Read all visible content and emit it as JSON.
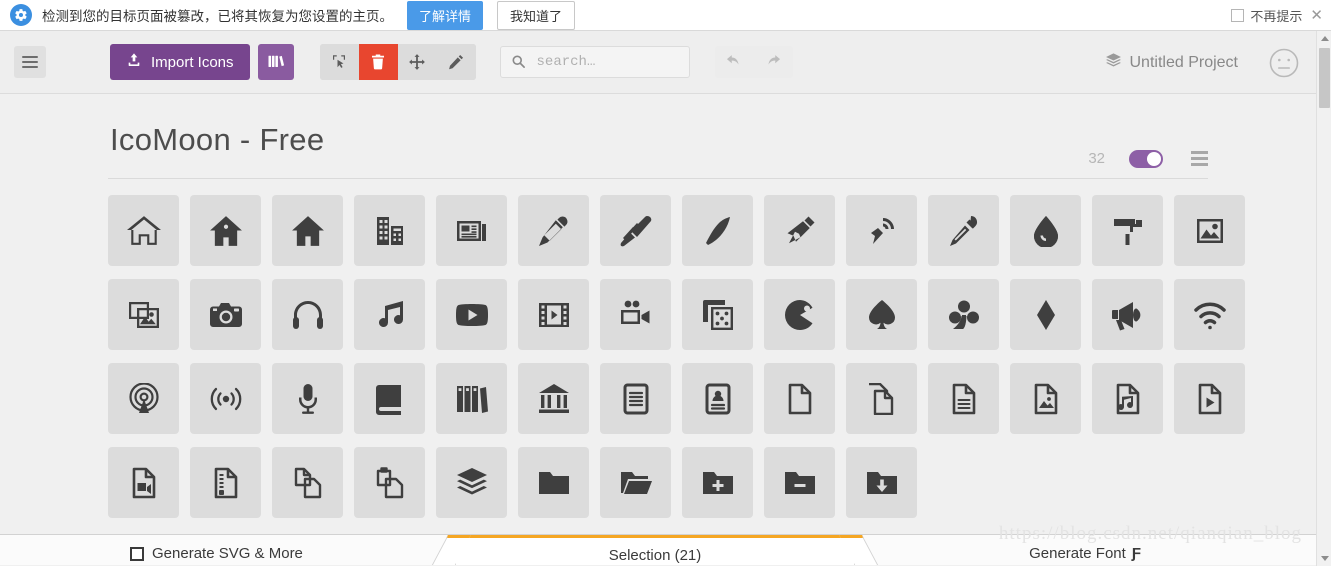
{
  "notice": {
    "gear_icon": "gear-icon",
    "message": "检测到您的目标页面被篡改，已将其恢复为您设置的主页。",
    "primary_button": "了解详情",
    "secondary_button": "我知道了",
    "dont_show_label": "不再提示",
    "close_icon": "close-icon",
    "primary_color": "#4a9ae8"
  },
  "toolbar": {
    "menu_icon": "hamburger-icon",
    "import_label": "Import Icons",
    "import_icon": "upload-icon",
    "library_icon": "library-books-icon",
    "purple": "#77458e",
    "tools": [
      {
        "name": "select-tool",
        "icon": "cursor-select-icon",
        "active": false
      },
      {
        "name": "delete-tool",
        "icon": "trash-icon",
        "active": true
      },
      {
        "name": "move-tool",
        "icon": "move-arrows-icon",
        "active": false
      },
      {
        "name": "edit-tool",
        "icon": "pencil-icon",
        "active": false
      }
    ],
    "delete_color": "#e8462f",
    "search_placeholder": "search…",
    "search_value": "",
    "search_icon": "search-icon",
    "undo_icon": "undo-arrow-icon",
    "redo_icon": "redo-arrow-icon",
    "project_name": "Untitled Project",
    "project_icon": "stack-layers-icon",
    "face_icon": "neutral-face-icon"
  },
  "set": {
    "title": "IcoMoon - Free",
    "count": "32",
    "toggle_on": true,
    "toggle_color": "#8d5fa6",
    "menu_icon": "set-menu-icon"
  },
  "icons": [
    "home",
    "home2",
    "home3",
    "office",
    "newspaper",
    "pencil",
    "pencil2",
    "quill",
    "pen",
    "blog",
    "eyedropper",
    "droplet",
    "paint-format",
    "image",
    "images",
    "camera",
    "headphones",
    "music",
    "play",
    "film",
    "video-camera",
    "dice",
    "pacman",
    "spades",
    "clubs",
    "diamonds",
    "bullhorn",
    "connection",
    "podcast",
    "feed",
    "mic",
    "book",
    "books",
    "library",
    "file-text",
    "profile",
    "file-empty",
    "files-empty",
    "file-text2",
    "file-picture",
    "file-music",
    "file-play",
    "file-video",
    "file-zip",
    "copy",
    "paste",
    "stack",
    "folder",
    "folder-open",
    "folder-plus",
    "folder-minus",
    "folder-download"
  ],
  "bottom": {
    "generate_svg_label": "Generate SVG & More",
    "selection_label": "Selection (21)",
    "generate_font_label": "Generate Font",
    "font_icon": "f-bold-icon",
    "active_tab_color": "#f5a623"
  },
  "watermark": "https://blog.csdn.net/qianqian_blog"
}
